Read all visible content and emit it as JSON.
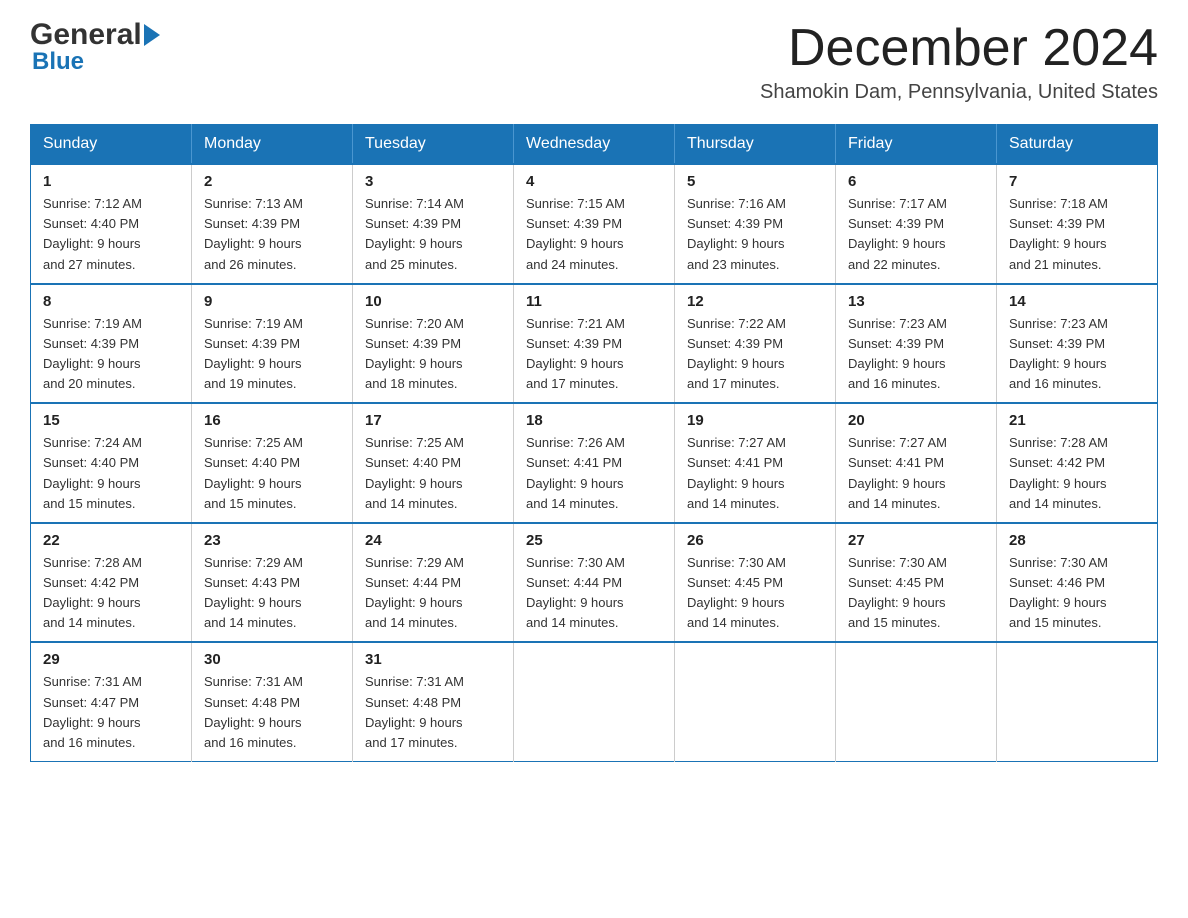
{
  "header": {
    "month_title": "December 2024",
    "location": "Shamokin Dam, Pennsylvania, United States",
    "logo_general": "General",
    "logo_blue": "Blue"
  },
  "days_of_week": [
    "Sunday",
    "Monday",
    "Tuesday",
    "Wednesday",
    "Thursday",
    "Friday",
    "Saturday"
  ],
  "weeks": [
    [
      {
        "day": "1",
        "sunrise": "Sunrise: 7:12 AM",
        "sunset": "Sunset: 4:40 PM",
        "daylight": "Daylight: 9 hours",
        "daylight2": "and 27 minutes."
      },
      {
        "day": "2",
        "sunrise": "Sunrise: 7:13 AM",
        "sunset": "Sunset: 4:39 PM",
        "daylight": "Daylight: 9 hours",
        "daylight2": "and 26 minutes."
      },
      {
        "day": "3",
        "sunrise": "Sunrise: 7:14 AM",
        "sunset": "Sunset: 4:39 PM",
        "daylight": "Daylight: 9 hours",
        "daylight2": "and 25 minutes."
      },
      {
        "day": "4",
        "sunrise": "Sunrise: 7:15 AM",
        "sunset": "Sunset: 4:39 PM",
        "daylight": "Daylight: 9 hours",
        "daylight2": "and 24 minutes."
      },
      {
        "day": "5",
        "sunrise": "Sunrise: 7:16 AM",
        "sunset": "Sunset: 4:39 PM",
        "daylight": "Daylight: 9 hours",
        "daylight2": "and 23 minutes."
      },
      {
        "day": "6",
        "sunrise": "Sunrise: 7:17 AM",
        "sunset": "Sunset: 4:39 PM",
        "daylight": "Daylight: 9 hours",
        "daylight2": "and 22 minutes."
      },
      {
        "day": "7",
        "sunrise": "Sunrise: 7:18 AM",
        "sunset": "Sunset: 4:39 PM",
        "daylight": "Daylight: 9 hours",
        "daylight2": "and 21 minutes."
      }
    ],
    [
      {
        "day": "8",
        "sunrise": "Sunrise: 7:19 AM",
        "sunset": "Sunset: 4:39 PM",
        "daylight": "Daylight: 9 hours",
        "daylight2": "and 20 minutes."
      },
      {
        "day": "9",
        "sunrise": "Sunrise: 7:19 AM",
        "sunset": "Sunset: 4:39 PM",
        "daylight": "Daylight: 9 hours",
        "daylight2": "and 19 minutes."
      },
      {
        "day": "10",
        "sunrise": "Sunrise: 7:20 AM",
        "sunset": "Sunset: 4:39 PM",
        "daylight": "Daylight: 9 hours",
        "daylight2": "and 18 minutes."
      },
      {
        "day": "11",
        "sunrise": "Sunrise: 7:21 AM",
        "sunset": "Sunset: 4:39 PM",
        "daylight": "Daylight: 9 hours",
        "daylight2": "and 17 minutes."
      },
      {
        "day": "12",
        "sunrise": "Sunrise: 7:22 AM",
        "sunset": "Sunset: 4:39 PM",
        "daylight": "Daylight: 9 hours",
        "daylight2": "and 17 minutes."
      },
      {
        "day": "13",
        "sunrise": "Sunrise: 7:23 AM",
        "sunset": "Sunset: 4:39 PM",
        "daylight": "Daylight: 9 hours",
        "daylight2": "and 16 minutes."
      },
      {
        "day": "14",
        "sunrise": "Sunrise: 7:23 AM",
        "sunset": "Sunset: 4:39 PM",
        "daylight": "Daylight: 9 hours",
        "daylight2": "and 16 minutes."
      }
    ],
    [
      {
        "day": "15",
        "sunrise": "Sunrise: 7:24 AM",
        "sunset": "Sunset: 4:40 PM",
        "daylight": "Daylight: 9 hours",
        "daylight2": "and 15 minutes."
      },
      {
        "day": "16",
        "sunrise": "Sunrise: 7:25 AM",
        "sunset": "Sunset: 4:40 PM",
        "daylight": "Daylight: 9 hours",
        "daylight2": "and 15 minutes."
      },
      {
        "day": "17",
        "sunrise": "Sunrise: 7:25 AM",
        "sunset": "Sunset: 4:40 PM",
        "daylight": "Daylight: 9 hours",
        "daylight2": "and 14 minutes."
      },
      {
        "day": "18",
        "sunrise": "Sunrise: 7:26 AM",
        "sunset": "Sunset: 4:41 PM",
        "daylight": "Daylight: 9 hours",
        "daylight2": "and 14 minutes."
      },
      {
        "day": "19",
        "sunrise": "Sunrise: 7:27 AM",
        "sunset": "Sunset: 4:41 PM",
        "daylight": "Daylight: 9 hours",
        "daylight2": "and 14 minutes."
      },
      {
        "day": "20",
        "sunrise": "Sunrise: 7:27 AM",
        "sunset": "Sunset: 4:41 PM",
        "daylight": "Daylight: 9 hours",
        "daylight2": "and 14 minutes."
      },
      {
        "day": "21",
        "sunrise": "Sunrise: 7:28 AM",
        "sunset": "Sunset: 4:42 PM",
        "daylight": "Daylight: 9 hours",
        "daylight2": "and 14 minutes."
      }
    ],
    [
      {
        "day": "22",
        "sunrise": "Sunrise: 7:28 AM",
        "sunset": "Sunset: 4:42 PM",
        "daylight": "Daylight: 9 hours",
        "daylight2": "and 14 minutes."
      },
      {
        "day": "23",
        "sunrise": "Sunrise: 7:29 AM",
        "sunset": "Sunset: 4:43 PM",
        "daylight": "Daylight: 9 hours",
        "daylight2": "and 14 minutes."
      },
      {
        "day": "24",
        "sunrise": "Sunrise: 7:29 AM",
        "sunset": "Sunset: 4:44 PM",
        "daylight": "Daylight: 9 hours",
        "daylight2": "and 14 minutes."
      },
      {
        "day": "25",
        "sunrise": "Sunrise: 7:30 AM",
        "sunset": "Sunset: 4:44 PM",
        "daylight": "Daylight: 9 hours",
        "daylight2": "and 14 minutes."
      },
      {
        "day": "26",
        "sunrise": "Sunrise: 7:30 AM",
        "sunset": "Sunset: 4:45 PM",
        "daylight": "Daylight: 9 hours",
        "daylight2": "and 14 minutes."
      },
      {
        "day": "27",
        "sunrise": "Sunrise: 7:30 AM",
        "sunset": "Sunset: 4:45 PM",
        "daylight": "Daylight: 9 hours",
        "daylight2": "and 15 minutes."
      },
      {
        "day": "28",
        "sunrise": "Sunrise: 7:30 AM",
        "sunset": "Sunset: 4:46 PM",
        "daylight": "Daylight: 9 hours",
        "daylight2": "and 15 minutes."
      }
    ],
    [
      {
        "day": "29",
        "sunrise": "Sunrise: 7:31 AM",
        "sunset": "Sunset: 4:47 PM",
        "daylight": "Daylight: 9 hours",
        "daylight2": "and 16 minutes."
      },
      {
        "day": "30",
        "sunrise": "Sunrise: 7:31 AM",
        "sunset": "Sunset: 4:48 PM",
        "daylight": "Daylight: 9 hours",
        "daylight2": "and 16 minutes."
      },
      {
        "day": "31",
        "sunrise": "Sunrise: 7:31 AM",
        "sunset": "Sunset: 4:48 PM",
        "daylight": "Daylight: 9 hours",
        "daylight2": "and 17 minutes."
      },
      null,
      null,
      null,
      null
    ]
  ]
}
